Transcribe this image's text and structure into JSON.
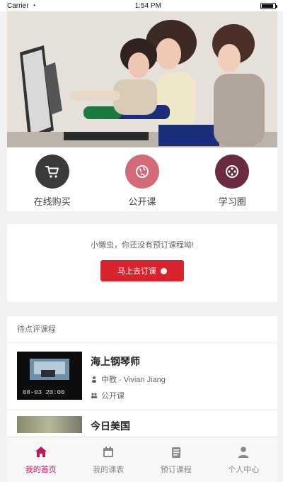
{
  "status_bar": {
    "carrier": "Carrier",
    "time": "1:54 PM"
  },
  "hero": {
    "image_semantic": "banner-photo"
  },
  "quick_menu": [
    {
      "label": "在线购买",
      "icon": "shopping-cart-icon",
      "color": "#3a3a3a"
    },
    {
      "label": "公开课",
      "icon": "globe-icon",
      "color": "#d46a78"
    },
    {
      "label": "学习圈",
      "icon": "film-reel-icon",
      "color": "#6a2b42"
    }
  ],
  "notice": {
    "text": "小懒虫，你还没有预订课程呦!",
    "button_label": "马上去订课"
  },
  "pending": {
    "title": "待点评课程",
    "courses": [
      {
        "title": "海上钢琴师",
        "teacher": "中教 - Vivian Jiang",
        "type": "公开课",
        "time": "08-03 20:00"
      },
      {
        "title": "今日美国"
      }
    ]
  },
  "tabbar": [
    {
      "label": "我的首页",
      "icon": "home-icon",
      "active": true
    },
    {
      "label": "我的课表",
      "icon": "calendar-icon",
      "active": false
    },
    {
      "label": "预订课程",
      "icon": "booking-icon",
      "active": false
    },
    {
      "label": "个人中心",
      "icon": "user-icon",
      "active": false
    }
  ],
  "colors": {
    "accent": "#c2185b",
    "button": "#d9232d"
  }
}
